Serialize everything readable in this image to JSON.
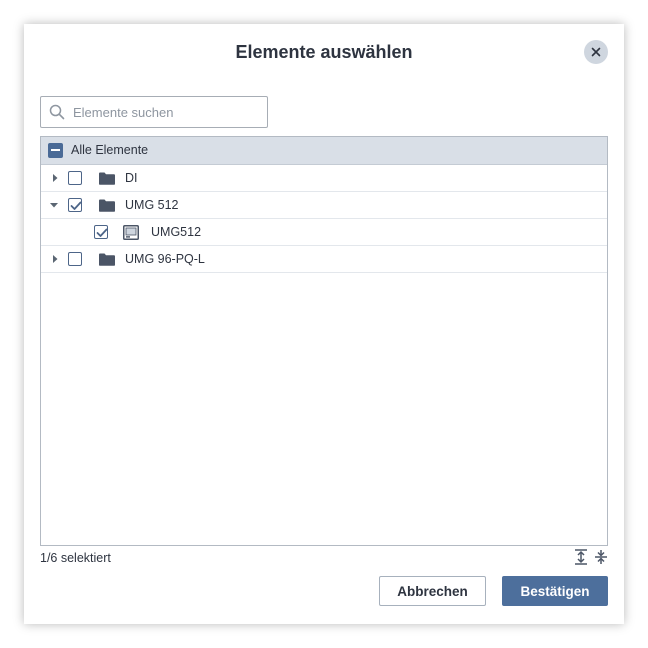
{
  "dialog": {
    "title": "Elemente auswählen",
    "close_icon": "close-icon"
  },
  "search": {
    "placeholder": "Elemente suchen",
    "value": "",
    "icon": "search-icon"
  },
  "tree": {
    "header": {
      "label": "Alle Elemente",
      "checkbox_state": "indeterminate"
    },
    "rows": [
      {
        "label": "DI",
        "type": "folder",
        "expanded": false,
        "checked": false,
        "level": 0
      },
      {
        "label": "UMG 512",
        "type": "folder",
        "expanded": true,
        "checked": true,
        "level": 0
      },
      {
        "label": "UMG512",
        "type": "device",
        "checked": true,
        "level": 1
      },
      {
        "label": "UMG 96-PQ-L",
        "type": "folder",
        "expanded": false,
        "checked": false,
        "level": 0
      }
    ]
  },
  "footer": {
    "selection_status": "1/6 selektiert",
    "expand_all_icon": "expand-all-icon",
    "collapse_all_icon": "collapse-all-icon",
    "cancel_label": "Abbrechen",
    "confirm_label": "Bestätigen"
  },
  "colors": {
    "primary": "#4d6f9c",
    "header_bg": "#d9dfe7",
    "text": "#2e3440",
    "close_bg": "#cfd6df"
  }
}
